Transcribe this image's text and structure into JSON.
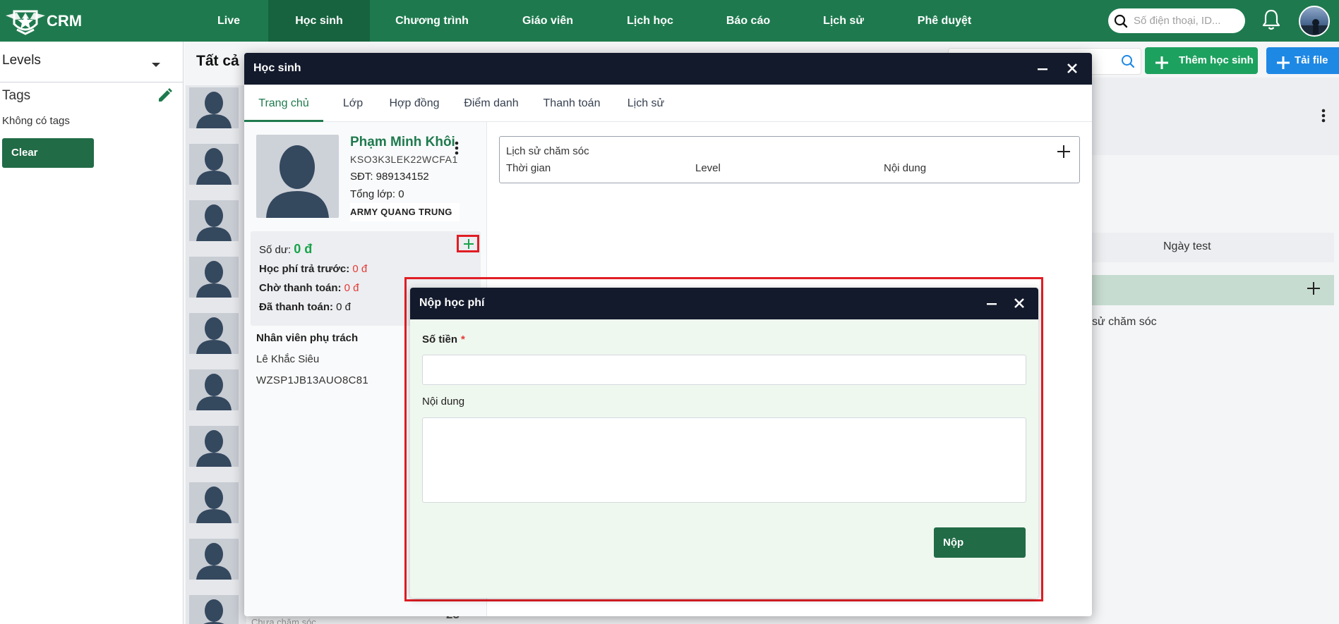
{
  "app": {
    "brand": "CRM"
  },
  "nav": {
    "items": [
      {
        "label": "Live"
      },
      {
        "label": "Học sinh"
      },
      {
        "label": "Chương trình"
      },
      {
        "label": "Giáo viên"
      },
      {
        "label": "Lịch học"
      },
      {
        "label": "Báo cáo"
      },
      {
        "label": "Lịch sử"
      },
      {
        "label": "Phê duyệt"
      }
    ],
    "active": "Học sinh",
    "search_placeholder": "Số điện thoại, ID..."
  },
  "sidebar": {
    "levels_label": "Levels",
    "tags_title": "Tags",
    "no_tags": "Không có tags",
    "clear_label": "Clear"
  },
  "background": {
    "title": "Tất cả",
    "add_student_label": "Thêm học sinh",
    "upload_label": "Tải file",
    "col_test_date": "Ngày test",
    "care_history_partial": "sử chăm sóc",
    "row_status_partial": "Chưa chăm sóc",
    "row_count_partial": "23"
  },
  "student_dialog": {
    "title": "Học sinh",
    "tabs": [
      "Trang chủ",
      "Lớp",
      "Hợp đồng",
      "Điểm danh",
      "Thanh toán",
      "Lịch sử"
    ],
    "active_tab": "Trang chủ",
    "student": {
      "name": "Phạm Minh Khôi",
      "code": "KSO3K3LEK22WCFA1",
      "phone": "SĐT: 989134152",
      "total_classes": "Tổng lớp: 0",
      "branch": "ARMY QUANG TRUNG"
    },
    "finance": {
      "balance_label": "Số dư:",
      "balance_value": "0 đ",
      "prepaid_label": "Học phí trả trước:",
      "prepaid_value": "0 đ",
      "pending_label": "Chờ thanh toán:",
      "pending_value": "0 đ",
      "paid_label": "Đã thanh toán:",
      "paid_value": "0 đ"
    },
    "staff": {
      "title": "Nhân viên phụ trách",
      "name": "Lê Khắc Siêu",
      "code": "WZSP1JB13AUO8C81"
    },
    "care_history": {
      "title": "Lịch sử chăm sóc",
      "columns": [
        "Thời gian",
        "Level",
        "Nội dung"
      ]
    }
  },
  "payment_dialog": {
    "title": "Nộp học phí",
    "amount_label": "Số tiền",
    "required_mark": "*",
    "amount_value": "",
    "content_label": "Nội dung",
    "content_value": "",
    "submit_label": "Nộp"
  },
  "colors": {
    "brand_green": "#1e7a4e",
    "dark_header": "#131a2c",
    "button_green": "#216b46",
    "add_green": "#1da15f",
    "upload_blue": "#1e88e5",
    "highlight_red": "#e11d24",
    "money_green": "#18a34a",
    "money_red": "#e53935"
  }
}
